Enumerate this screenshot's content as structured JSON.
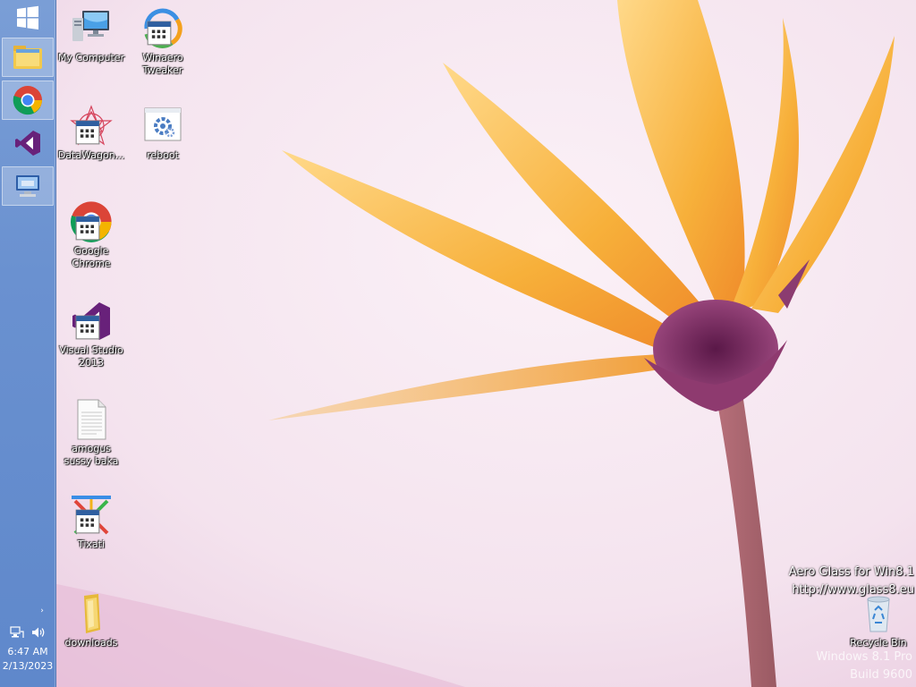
{
  "taskbar": {
    "start_icon": "windows-logo-icon",
    "pinned": [
      {
        "name": "file-explorer-icon",
        "active": true
      },
      {
        "name": "chrome-icon",
        "active": true
      },
      {
        "name": "visual-studio-icon",
        "active": false
      },
      {
        "name": "remote-desktop-icon",
        "active": true
      }
    ],
    "tray": {
      "chevron": "›",
      "time": "6:47 AM",
      "date": "2/13/2023"
    }
  },
  "desktop": {
    "icons": [
      {
        "label": "My Computer",
        "icon": "computer-icon"
      },
      {
        "label": "Winaero Tweaker",
        "icon": "winaero-tweaker-icon"
      },
      {
        "label": "DataWagon...",
        "icon": "datawagon-icon"
      },
      {
        "label": "reboot",
        "icon": "reboot-icon"
      },
      {
        "label": "Google Chrome",
        "icon": "chrome-icon"
      },
      {
        "label": "Visual Studio 2013",
        "icon": "visual-studio-icon"
      },
      {
        "label": "amogus sussy baka",
        "icon": "text-file-icon"
      },
      {
        "label": "Tixati",
        "icon": "tixati-icon"
      },
      {
        "label": "downloads",
        "icon": "folder-icon"
      },
      {
        "label": "Recycle Bin",
        "icon": "recycle-bin-icon"
      }
    ]
  },
  "watermark": {
    "line1": "Aero Glass for Win8.1",
    "line2": "http://www.glass8.eu",
    "line3": "Windows 8.1 Pro",
    "line4": "Build 9600"
  },
  "colors": {
    "taskbar": "#6a91d0",
    "wallpaper_bg": "#f6e9f2",
    "petal": "#f5b43c",
    "flower_center": "#7a2a5c"
  }
}
